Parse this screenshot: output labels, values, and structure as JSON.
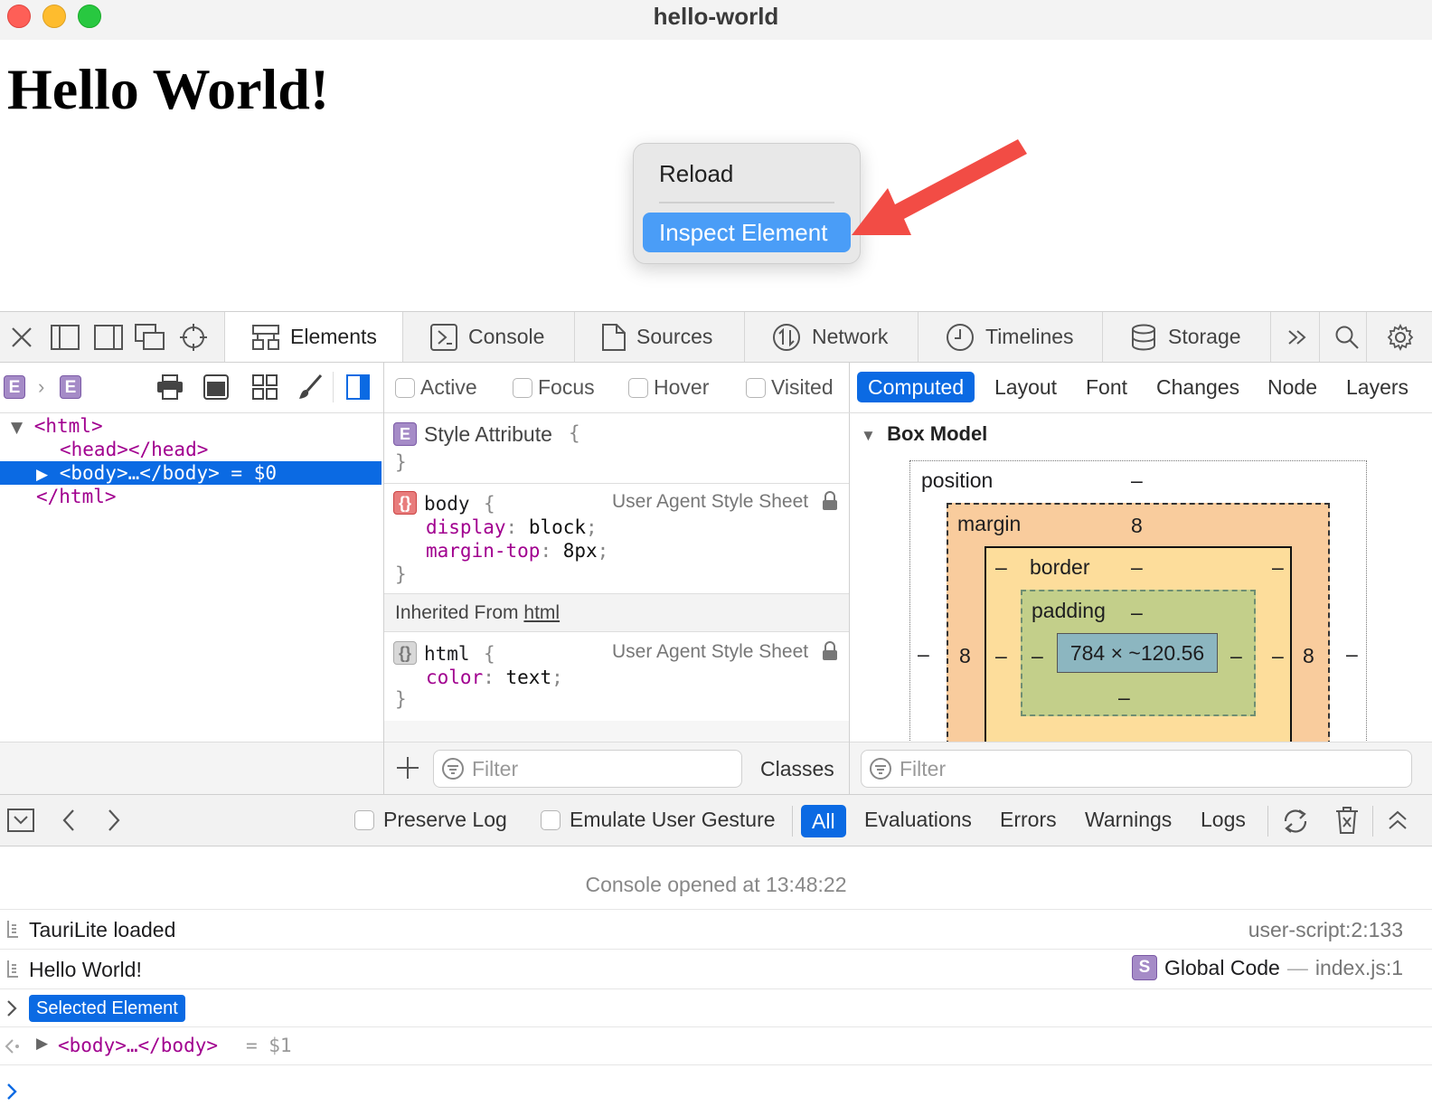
{
  "window": {
    "title": "hello-world"
  },
  "page": {
    "heading": "Hello World!"
  },
  "context_menu": {
    "items": [
      "Reload",
      "Inspect Element"
    ],
    "highlighted": "Inspect Element"
  },
  "devtools": {
    "tabs": [
      {
        "label": "Elements",
        "icon": "elements-icon",
        "active": true
      },
      {
        "label": "Console",
        "icon": "console-icon"
      },
      {
        "label": "Sources",
        "icon": "sources-icon"
      },
      {
        "label": "Network",
        "icon": "network-icon"
      },
      {
        "label": "Timelines",
        "icon": "timelines-icon"
      },
      {
        "label": "Storage",
        "icon": "storage-icon"
      }
    ],
    "elements": {
      "breadcrumb": [
        "E",
        "E"
      ],
      "dom": {
        "line1": "<html>",
        "line2": "<head></head>",
        "line3_tag": "<body>…</body>",
        "line3_ref": "= $0",
        "line4": "</html>"
      }
    },
    "styles": {
      "pseudo": [
        "Active",
        "Focus",
        "Hover",
        "Visited"
      ],
      "style_attribute": {
        "icon": "E",
        "label": "Style Attribute",
        "open": "{",
        "close": "}"
      },
      "body_rule": {
        "selector": "body",
        "source": "User Agent Style Sheet",
        "open": "{",
        "close": "}",
        "p1": "display",
        "v1": "block",
        "p2": "margin-top",
        "v2": "8px"
      },
      "inherited_prefix": "Inherited From",
      "inherited_link": "html",
      "html_rule": {
        "selector": "html",
        "source": "User Agent Style Sheet",
        "open": "{",
        "close": "}",
        "p1": "color",
        "v1": "text"
      },
      "filter_placeholder": "Filter",
      "classes_label": "Classes"
    },
    "computed": {
      "tabs": [
        "Computed",
        "Layout",
        "Font",
        "Changes",
        "Node",
        "Layers"
      ],
      "active_tab": "Computed",
      "section_title": "Box Model",
      "box_model": {
        "position_label": "position",
        "position_top": "–",
        "margin_label": "margin",
        "margin_top": "8",
        "margin_left": "8",
        "margin_right": "8",
        "border_label": "border",
        "border_top": "–",
        "padding_label": "padding",
        "padding_top": "–",
        "padding_bottom": "–",
        "content": "784 × ~120.56",
        "dash": "–"
      },
      "filter_placeholder": "Filter"
    },
    "console": {
      "toolbar": {
        "preserve_log": "Preserve Log",
        "emulate_gesture": "Emulate User Gesture",
        "filters": [
          "All",
          "Evaluations",
          "Errors",
          "Warnings",
          "Logs"
        ],
        "active_filter": "All"
      },
      "opened_at": "Console opened at 13:48:22",
      "messages": [
        {
          "text": "TauriLite loaded",
          "source": "user-script:2:133"
        },
        {
          "text": "Hello World!",
          "source_badge": "S",
          "source_func": "Global Code",
          "source_sep": "—",
          "source_file": "index.js:1"
        }
      ],
      "selected_element_badge": "Selected Element",
      "result_tag": "<body>…</body>",
      "result_ref": "= $1"
    }
  },
  "colors": {
    "accent": "#0b6ae3",
    "menu_highlight": "#4a9df7",
    "tag": "#a1008f",
    "annotation_arrow": "#f24c45",
    "margin_box": "#f9cc9d",
    "border_box": "#fddd9b",
    "padding_box": "#c3cf8a",
    "content_box": "#8cb6c0"
  }
}
